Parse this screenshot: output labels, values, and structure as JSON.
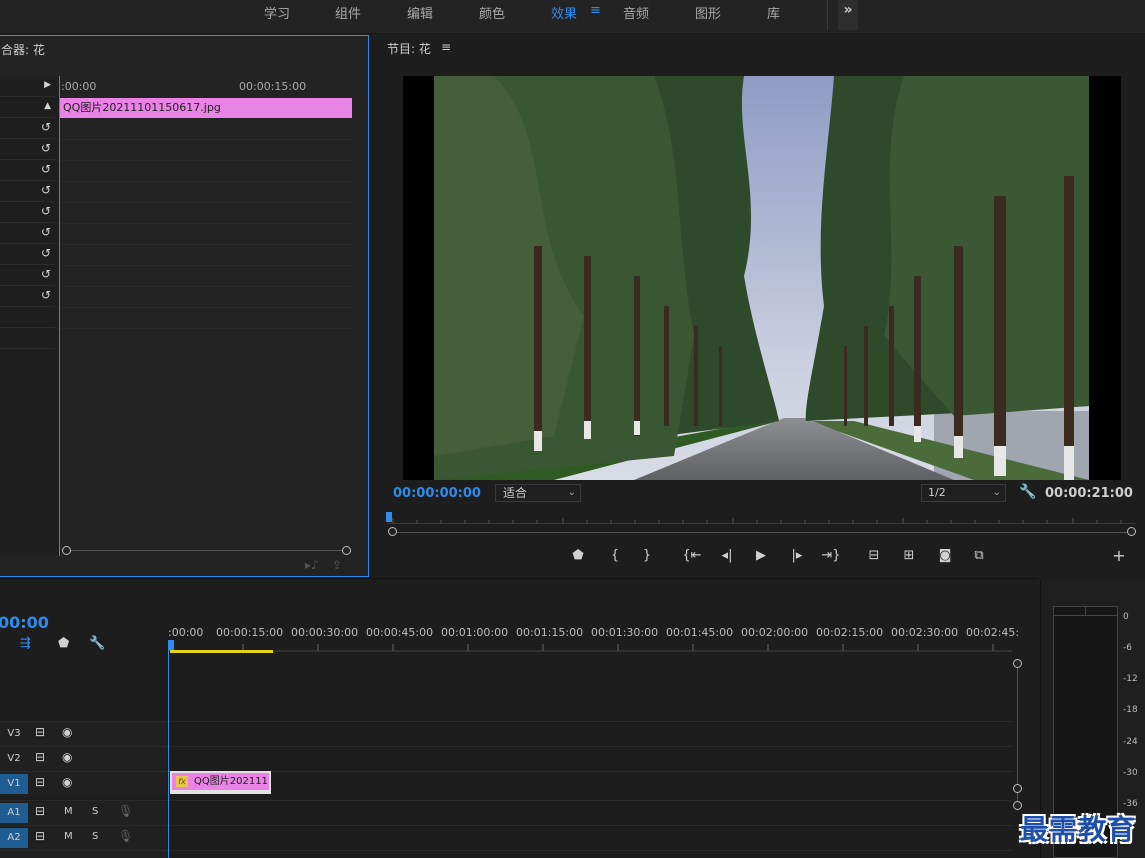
{
  "workspace_bar": {
    "tabs": [
      {
        "label": "学习",
        "active": false
      },
      {
        "label": "组件",
        "active": false
      },
      {
        "label": "编辑",
        "active": false
      },
      {
        "label": "颜色",
        "active": false
      },
      {
        "label": "效果",
        "active": true
      },
      {
        "label": "音频",
        "active": false
      },
      {
        "label": "图形",
        "active": false
      },
      {
        "label": "库",
        "active": false
      }
    ],
    "more_icon": "»",
    "accent_color": "#2d8ceb"
  },
  "effect_controls": {
    "title": "合器: 花",
    "ruler_start": ":00:00",
    "ruler_mark": "00:00:15:00",
    "clip_name": "QQ图片20211101150617.jpg",
    "clip_color": "#e983e6",
    "reset_icon": "↺",
    "reset_rows": 9
  },
  "program_monitor": {
    "title": "节目: 花",
    "menu_icon": "≡",
    "timecode": "00:00:00:00",
    "fit": "适合",
    "resolution": "1/2",
    "duration": "00:00:21:00",
    "transport": {
      "marker": "marker-icon",
      "in": "{",
      "out": "}",
      "go_in": "go-to-in-icon",
      "step_back": "step-back-icon",
      "play": "play-icon",
      "step_forward": "step-forward-icon",
      "go_out": "go-to-out-icon",
      "lift": "lift-icon",
      "extract": "extract-icon",
      "export_frame": "camera-icon",
      "compare": "compare-icon",
      "add": "+"
    }
  },
  "timeline": {
    "timecode": "00:00",
    "ruler_labels": [
      ":00:00",
      "00:00:15:00",
      "00:00:30:00",
      "00:00:45:00",
      "00:01:00:00",
      "00:01:15:00",
      "00:01:30:00",
      "00:01:45:00",
      "00:02:00:00",
      "00:02:15:00",
      "00:02:30:00",
      "00:02:45:"
    ],
    "tracks": [
      {
        "label": "V3",
        "type": "video",
        "targeted": false
      },
      {
        "label": "V2",
        "type": "video",
        "targeted": false
      },
      {
        "label": "V1",
        "type": "video",
        "targeted": true
      },
      {
        "label": "A1",
        "type": "audio",
        "targeted": true
      },
      {
        "label": "A2",
        "type": "audio",
        "targeted": true
      }
    ],
    "audio_buttons": {
      "mute": "M",
      "solo": "S"
    },
    "clip": {
      "label": "QQ图片202111",
      "fx": "fx"
    }
  },
  "audio_meter": {
    "scale": [
      "0",
      "-6",
      "-12",
      "-18",
      "-24",
      "-30",
      "-36"
    ]
  },
  "watermark": "最需教育"
}
